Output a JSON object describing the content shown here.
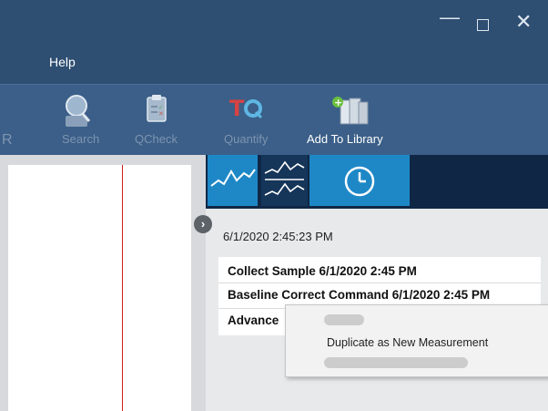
{
  "window": {
    "minimize_glyph": "—",
    "close_glyph": "✕"
  },
  "menu": {
    "help": "Help"
  },
  "toolbar": {
    "clipped_label": "R",
    "items": [
      {
        "label": "Search",
        "icon": "search-icon",
        "enabled": false
      },
      {
        "label": "QCheck",
        "icon": "qcheck-icon",
        "enabled": false
      },
      {
        "label": "Quantify",
        "icon": "quantify-icon",
        "enabled": false
      },
      {
        "label": "Add To Library",
        "icon": "add-library-icon",
        "enabled": true
      }
    ]
  },
  "views": {
    "icons": [
      "spectrum-view-icon",
      "stacked-spectra-icon",
      "history-clock-icon"
    ]
  },
  "timestamp": "6/1/2020 2:45:23 PM",
  "history": [
    "Collect Sample  6/1/2020 2:45 PM",
    "Baseline Correct Command  6/1/2020 2:45 PM",
    "Advance"
  ],
  "context_menu": {
    "item": "Duplicate as New Measurement"
  },
  "colors": {
    "titlebar": "#2e4e72",
    "toolbar": "#3b5f88",
    "accent": "#1e88c7",
    "red_line": "#d21f1f"
  }
}
